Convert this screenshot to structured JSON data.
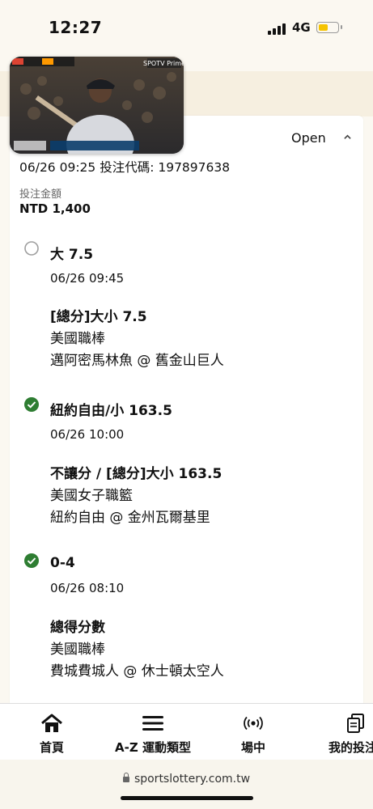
{
  "status_bar": {
    "time": "12:27",
    "network": "4G"
  },
  "video": {
    "broadcaster": "SPOTV Prime"
  },
  "bet": {
    "status": "Open",
    "meta": "06/26 09:25 投注代碼: 197897638",
    "amount_label": "投注金額",
    "amount_value": "NTD 1,400"
  },
  "selections": [
    {
      "status": "pending",
      "pick": "大 7.5",
      "time": "06/26 09:45",
      "market": "[總分]大小 7.5",
      "league": "美國職棒",
      "match": "邁阿密馬林魚 @ 舊金山巨人"
    },
    {
      "status": "won",
      "pick": "紐約自由/小 163.5",
      "time": "06/26 10:00",
      "market": "不讓分 / [總分]大小 163.5",
      "league": "美國女子職籃",
      "match": "紐約自由 @ 金州瓦爾基里"
    },
    {
      "status": "won",
      "pick": "0-4",
      "time": "06/26 08:10",
      "market": "總得分數",
      "league": "美國職棒",
      "match": "費城費城人 @ 休士頓太空人"
    }
  ],
  "nav": {
    "items": [
      {
        "label": "首頁",
        "icon": "home-icon"
      },
      {
        "label": "A-Z 運動類型",
        "icon": "menu-icon"
      },
      {
        "label": "場中",
        "icon": "live-broadcast-icon"
      },
      {
        "label": "我的投注",
        "icon": "copy-icon"
      }
    ]
  },
  "browser": {
    "url": "sportslottery.com.tw"
  },
  "colors": {
    "won_green": "#2e7d32",
    "pending_gray": "#9e9e9e",
    "page_bg": "#fbf8f1"
  }
}
